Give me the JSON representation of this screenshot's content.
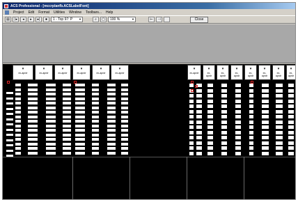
{
  "window": {
    "title": "ACS Professional - [mccrplanfb.ACSLabelFont]"
  },
  "menu": {
    "items": [
      "Project",
      "Edit",
      "Format",
      "Utilities",
      "Window",
      "Toolbars...",
      "Help"
    ]
  },
  "toolbar": {
    "nav_buttons": [
      "|◂",
      "◂",
      "▸",
      "▸|",
      "⏹"
    ],
    "page_select": "1 - Top 97: P",
    "zoom_select": "100 %",
    "close_label": "Close"
  },
  "layout": {
    "header_label": "ex-aprdr"
  },
  "colors": {
    "titlebar": "#0a246a",
    "sheet": "#000000",
    "bars": "#ffffff",
    "panel": "#a8a8a8",
    "marker": "#dd2222"
  },
  "icons": [
    "app-icon",
    "system-menu-icon",
    "print-icon",
    "first-icon",
    "prev-icon",
    "next-icon",
    "last-icon",
    "find-icon",
    "zoom-icon",
    "fit-width-icon",
    "fit-page-icon"
  ]
}
